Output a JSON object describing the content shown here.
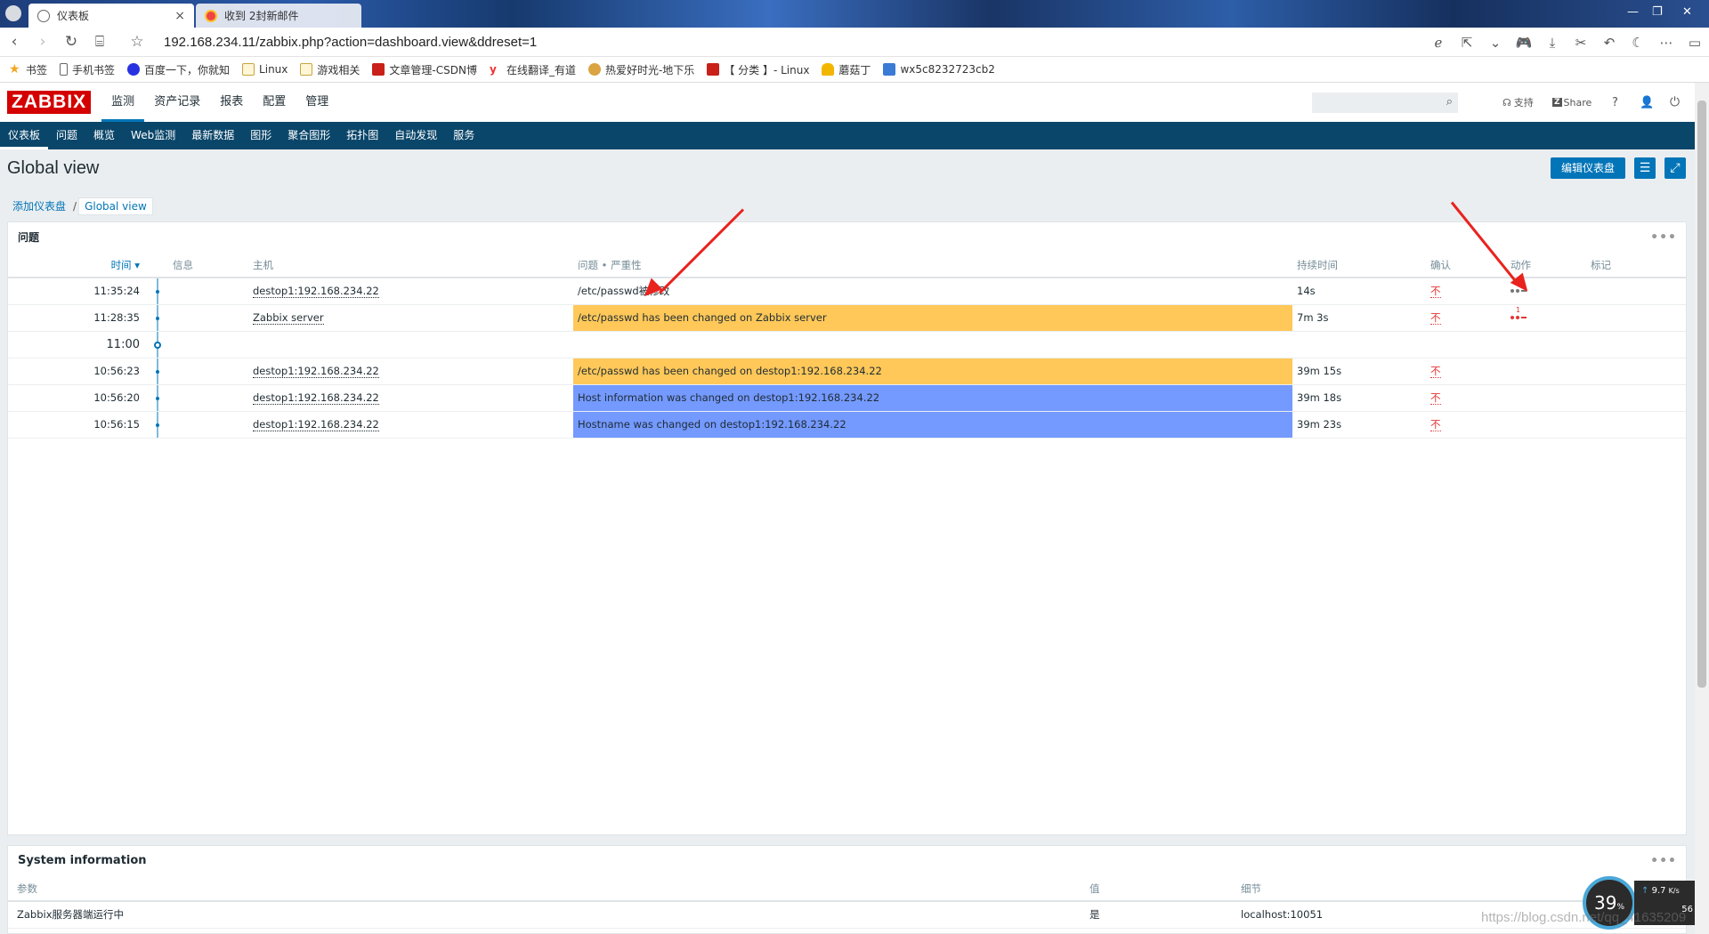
{
  "browser": {
    "tabs": [
      {
        "title": "仪表板"
      },
      {
        "title": "收到 2封新邮件"
      }
    ],
    "url": "192.168.234.11/zabbix.php?action=dashboard.view&ddreset=1",
    "bookmarks": [
      {
        "label": "书签"
      },
      {
        "label": "手机书签"
      },
      {
        "label": "百度一下，你就知"
      },
      {
        "label": "Linux"
      },
      {
        "label": "游戏相关"
      },
      {
        "label": "文章管理-CSDN博"
      },
      {
        "label": "在线翻译_有道"
      },
      {
        "label": "热爱好时光-地下乐"
      },
      {
        "label": "【 分类 】- Linux"
      },
      {
        "label": "蘑菇丁"
      },
      {
        "label": "wx5c8232723cb2"
      }
    ]
  },
  "zabbix": {
    "logo": "ZABBIX",
    "main_menu": [
      "监测",
      "资产记录",
      "报表",
      "配置",
      "管理"
    ],
    "support": "支持",
    "share": "Share",
    "help": "?",
    "sub_menu": [
      "仪表板",
      "问题",
      "概览",
      "Web监测",
      "最新数据",
      "图形",
      "聚合图形",
      "拓扑图",
      "自动发现",
      "服务"
    ]
  },
  "page": {
    "title": "Global view",
    "edit_button": "编辑仪表盘",
    "breadcrumb": {
      "parent": "添加仪表盘",
      "sep": "/",
      "current": "Global view"
    }
  },
  "problems_widget": {
    "title": "问题",
    "columns": [
      "时间 ▾",
      "信息",
      "主机",
      "问题 • 严重性",
      "持续时间",
      "确认",
      "动作",
      "标记"
    ],
    "rows": [
      {
        "time": "11:35:24",
        "host": "destop1:192.168.234.22",
        "problem": "/etc/passwd被修改",
        "severity": "none",
        "duration": "14s",
        "ack": "不",
        "action": "grey"
      },
      {
        "time": "11:28:35",
        "host": "Zabbix server",
        "problem": "/etc/passwd has been changed on Zabbix server",
        "severity": "average",
        "duration": "7m 3s",
        "ack": "不",
        "action": "red",
        "action_count": "1"
      },
      {
        "hour": "11:00"
      },
      {
        "time": "10:56:23",
        "host": "destop1:192.168.234.22",
        "problem": "/etc/passwd has been changed on destop1:192.168.234.22",
        "severity": "average",
        "duration": "39m 15s",
        "ack": "不"
      },
      {
        "time": "10:56:20",
        "host": "destop1:192.168.234.22",
        "problem": "Host information was changed on destop1:192.168.234.22",
        "severity": "info",
        "duration": "39m 18s",
        "ack": "不"
      },
      {
        "time": "10:56:15",
        "host": "destop1:192.168.234.22",
        "problem": "Hostname was changed on destop1:192.168.234.22",
        "severity": "info",
        "duration": "39m 23s",
        "ack": "不"
      }
    ]
  },
  "sysinfo_widget": {
    "title": "System information",
    "columns": [
      "参数",
      "值",
      "细节"
    ],
    "rows": [
      {
        "param": "Zabbix服务器端运行中",
        "value": "是",
        "detail": "localhost:10051"
      }
    ]
  },
  "overlay": {
    "speed_percent": "39",
    "speed_unit": "%",
    "upload": "9.7",
    "upload_unit": "K/s",
    "download": "56",
    "watermark": "https://blog.csdn.net/qq_41635209"
  },
  "colors": {
    "zabbix_red": "#d40000",
    "nav_blue": "#0a466a",
    "link_blue": "#0275b8",
    "sev_average": "#ffc859",
    "sev_info": "#7499ff",
    "arrow_red": "#e8231e"
  }
}
